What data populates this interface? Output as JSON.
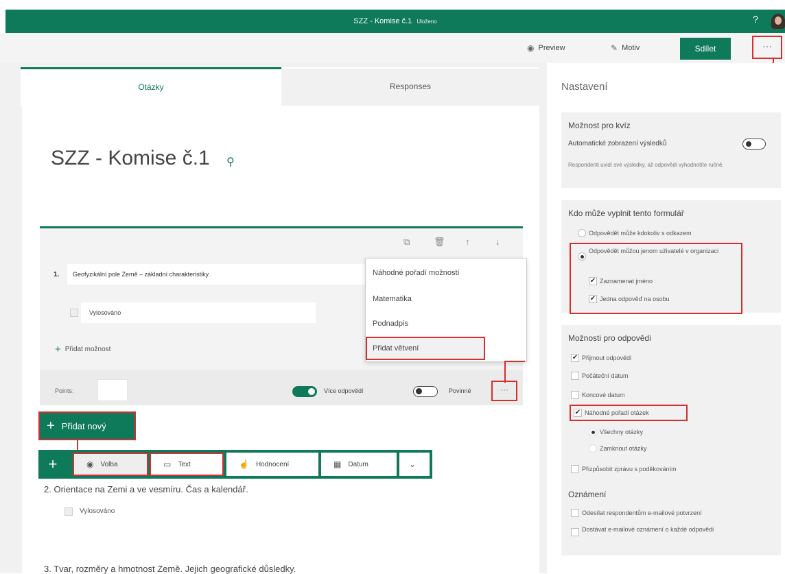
{
  "app": {
    "title": "SZZ - Komise č.1",
    "saved_status": "Uloženo",
    "help": "?"
  },
  "toolbar": {
    "preview": "Preview",
    "theme": "Motiv",
    "share": "Sdílet",
    "more": "···"
  },
  "tabs": {
    "questions": "Otázky",
    "responses": "Responses"
  },
  "form": {
    "title": "SZZ - Komise č.1"
  },
  "question1": {
    "number": "1.",
    "text": "Geofyzikální pole Země – základní charakteristiky.",
    "option": "Vylosováno",
    "add_option": "Přidat možnost",
    "points_label": "Points:",
    "multiple_answers": "Více odpovědí",
    "required": "Povinné",
    "more": "···"
  },
  "context_menu": {
    "items": [
      "Náhodné pořadí možností",
      "Matematika",
      "Podnadpis",
      "Přidat větvení"
    ]
  },
  "add_new": {
    "label": "Přidat nový"
  },
  "type_bar": {
    "choice": "Volba",
    "text": "Text",
    "rating": "Hodnocení",
    "date": "Datum"
  },
  "question2": {
    "text": "2. Orientace na Zemi a ve vesmíru. Čas a kalendář.",
    "option": "Vylosováno"
  },
  "question3": {
    "text": "3. Tvar, rozměry a hmotnost Země. Jejich geografické důsledky."
  },
  "settings": {
    "title": "Nastavení",
    "quiz": {
      "heading": "Možnost pro kvíz",
      "auto_results": "Automatické zobrazení výsledků",
      "note": "Respondenti uvidí své výsledky, až odpovědi vyhodnotíte ručně."
    },
    "who": {
      "heading": "Kdo může vyplnit tento formulář",
      "anyone": "Odpovědět může kdokoliv s odkazem",
      "org_only": "Odpovědět můžou jenom uživatelé v organizaci",
      "record_name": "Zaznamenat jméno",
      "one_response": "Jedna odpověď na osobu"
    },
    "responses": {
      "heading": "Možnosti pro odpovědi",
      "accept": "Přijmout odpovědi",
      "start_date": "Počáteční datum",
      "end_date": "Koncové datum",
      "shuffle": "Náhodné pořadí otázek",
      "all_questions": "Všechny otázky",
      "lock_questions": "Zamknout otázky",
      "thank_you": "Přizpůsobit zprávu s poděkováním"
    },
    "notifications": {
      "heading": "Oznámení",
      "email_receipt": "Odesílat respondentům e-mailové potvrzení",
      "email_each": "Dostávat e-mailové oznámení o každé odpovědi"
    }
  },
  "colors": {
    "accent": "#0f7a5a",
    "highlight": "#d32f2f"
  }
}
